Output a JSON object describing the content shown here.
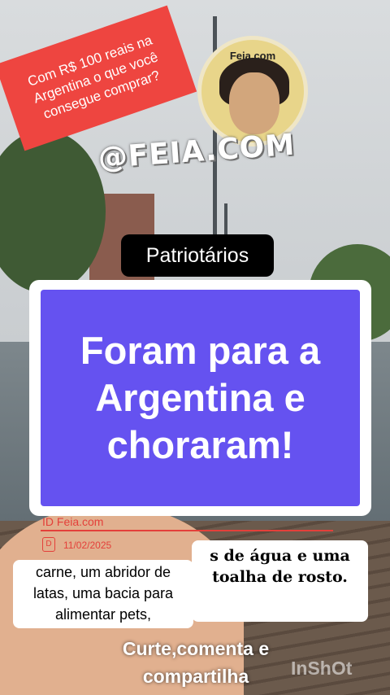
{
  "sticker": {
    "text": "Com R$ 100 reais na Argentina  o que  você consegue comprar?"
  },
  "logo": {
    "small_text": "Feia.com",
    "handle": "@FEIA.COM"
  },
  "tag": {
    "label": "Patriotários"
  },
  "headline": {
    "text": "Foram para a Argentina e choraram!"
  },
  "meta": {
    "id_label": "ID  Feia.com",
    "date": "11/02/2025",
    "icon_glyph": "D"
  },
  "captions": {
    "left": "carne, um abridor de latas, uma bacia para alimentar pets,",
    "right": "s de água e uma toalha de rosto."
  },
  "bottom": {
    "text": "Curte,comenta e compartilha"
  },
  "watermark": {
    "text": "InShOt"
  },
  "colors": {
    "sticker_red": "#ee4540",
    "headline_purple": "#6552f0",
    "meta_red": "#e4403a"
  }
}
